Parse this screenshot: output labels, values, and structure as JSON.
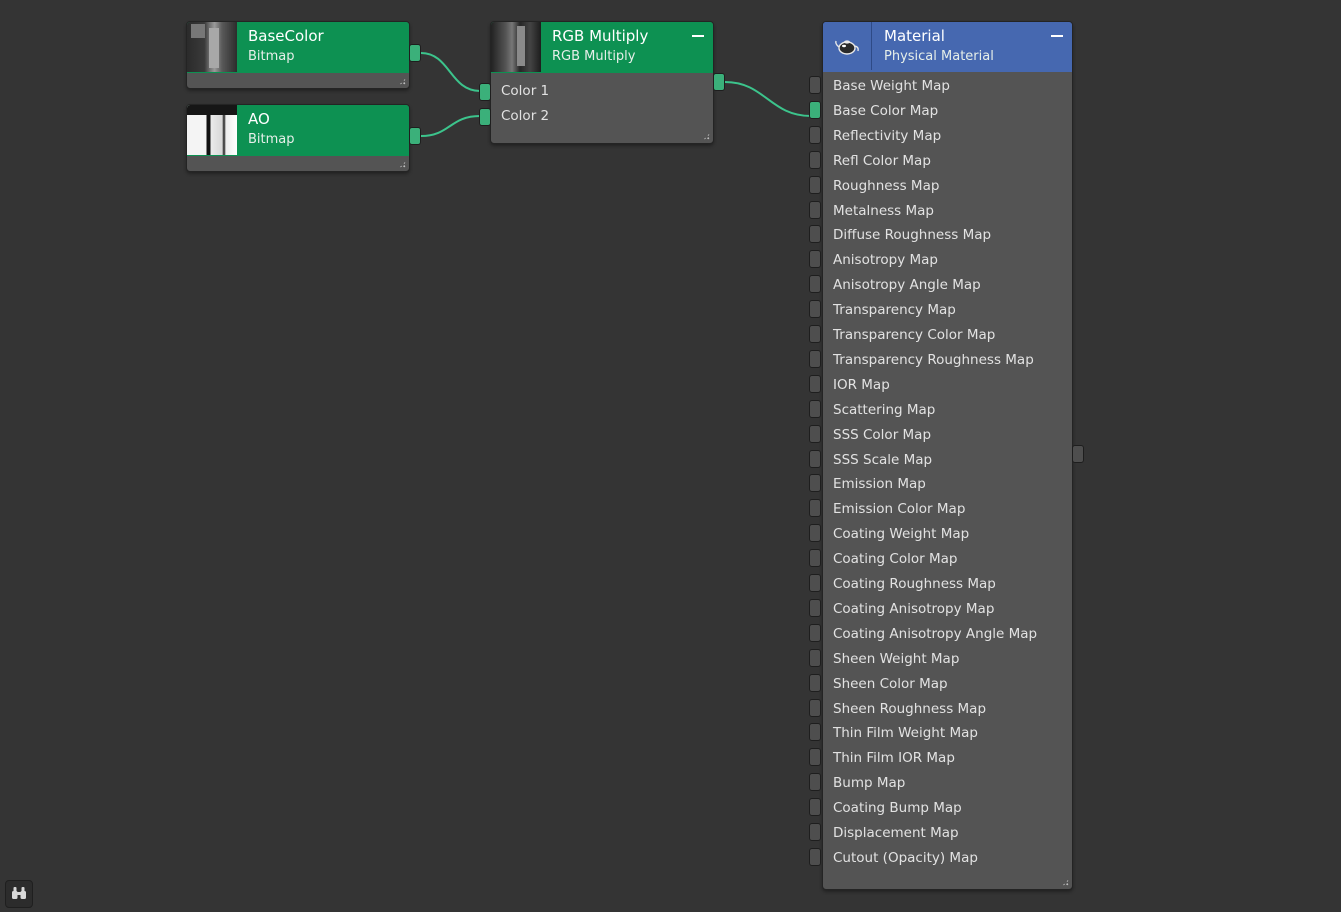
{
  "nodes": {
    "basecolor": {
      "title": "BaseColor",
      "subtitle": "Bitmap"
    },
    "ao": {
      "title": "AO",
      "subtitle": "Bitmap"
    },
    "rgb_multiply": {
      "title": "RGB Multiply",
      "subtitle": "RGB Multiply",
      "inputs": [
        "Color 1",
        "Color 2"
      ]
    },
    "material": {
      "title": "Material",
      "subtitle": "Physical Material",
      "icon": "teapot-icon",
      "slots": [
        "Base Weight Map",
        "Base Color Map",
        "Reflectivity Map",
        "Refl Color Map",
        "Roughness Map",
        "Metalness Map",
        "Diffuse Roughness Map",
        "Anisotropy Map",
        "Anisotropy Angle Map",
        "Transparency Map",
        "Transparency Color Map",
        "Transparency Roughness Map",
        "IOR Map",
        "Scattering Map",
        "SSS Color Map",
        "SSS Scale Map",
        "Emission Map",
        "Emission Color Map",
        "Coating Weight Map",
        "Coating Color Map",
        "Coating Roughness Map",
        "Coating Anisotropy Map",
        "Coating Anisotropy Angle Map",
        "Sheen Weight Map",
        "Sheen Color Map",
        "Sheen Roughness Map",
        "Thin Film Weight Map",
        "Thin Film IOR Map",
        "Bump Map",
        "Coating Bump Map",
        "Displacement Map",
        "Cutout (Opacity) Map"
      ],
      "connected_slot": "Base Color Map"
    }
  },
  "colors": {
    "canvas_bg": "#343434",
    "map_header": "#0d9152",
    "material_header": "#4668b0",
    "node_body": "#545454",
    "wire": "#3cc48c"
  },
  "toolbar": {
    "bottom_button_icon": "binoculars-icon"
  }
}
